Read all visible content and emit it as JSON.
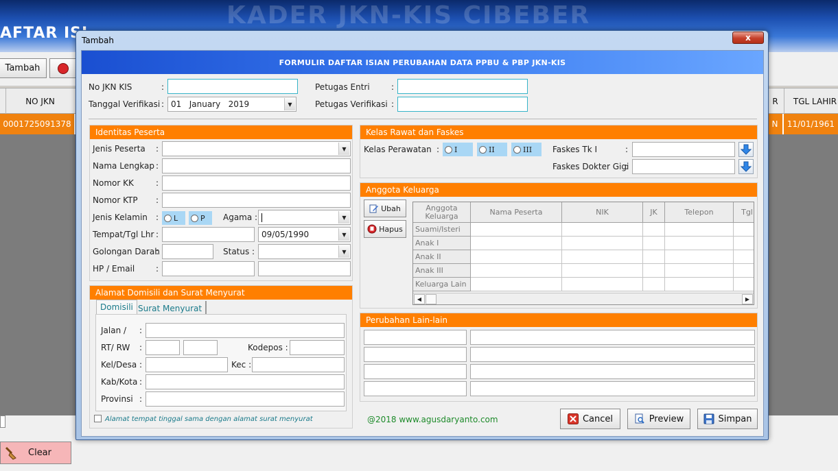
{
  "background": {
    "title": "AFTAR ISI",
    "header_ghost": "KADER JKN-KIS CIBEBER",
    "tambah_button": "Tambah",
    "clear_button": "Clear",
    "grid_headers": {
      "no_jkn": "NO JKN",
      "r": "R",
      "tgl_lahir": "TGL LAHIR"
    },
    "grid_row": {
      "no_jkn": "0001725091378",
      "r": "N",
      "tgl_lahir": "11/01/1961"
    }
  },
  "dialog": {
    "title": "Tambah",
    "close_label": "x",
    "banner": "FORMULIR DAFTAR ISIAN PERUBAHAN DATA PPBU & PBP JKN-KIS",
    "top": {
      "no_jkn_label": "No JKN KIS",
      "tanggal_label": "Tanggal Verifikasi",
      "tanggal_value": "01   January   2019",
      "petugas_entri_label": "Petugas Entri",
      "petugas_verif_label": "Petugas Verifikasi",
      "colon": ":"
    },
    "identitas": {
      "heading": "Identitas Peserta",
      "jenis_peserta": "Jenis Peserta",
      "nama_lengkap": "Nama Lengkap",
      "nomor_kk": "Nomor KK",
      "nomor_ktp": "Nomor KTP",
      "jenis_kelamin": "Jenis Kelamin",
      "gender_l": "L",
      "gender_p": "P",
      "agama": "Agama :",
      "tempat_tgl": "Tempat/Tgl Lhr",
      "tgl_value": "09/05/1990",
      "golongan_darah": "Golongan Darah",
      "status": "Status :",
      "hp_email": "HP / Email"
    },
    "alamat": {
      "heading": "Alamat Domisili dan Surat Menyurat",
      "tab_domisili": "Domisili",
      "tab_surat": "Surat Menyurat",
      "jalan": "Jalan /",
      "rt_rw": "RT/ RW",
      "kodepos": "Kodepos :",
      "kel_desa": "Kel/Desa",
      "kec": "Kec :",
      "kab_kota": "Kab/Kota",
      "provinsi": "Provinsi",
      "checkbox_label": "Alamat tempat tinggal sama dengan alamat surat menyurat"
    },
    "kelas": {
      "heading": "Kelas Rawat dan Faskes",
      "kelas_label": "Kelas Perawatan",
      "kelas_options": [
        "I",
        "II",
        "III"
      ],
      "faskes_tk1": "Faskes Tk I",
      "faskes_gigi": "Faskes Dokter Gigi"
    },
    "anggota": {
      "heading": "Anggota Keluarga",
      "ubah": "Ubah",
      "hapus": "Hapus",
      "columns": [
        "Anggota Keluarga",
        "Nama Peserta",
        "NIK",
        "JK",
        "Telepon",
        "Tgl"
      ],
      "rows": [
        "Suami/Isteri",
        "Anak I",
        "Anak II",
        "Anak III",
        "Keluarga Lain"
      ]
    },
    "perubahan": {
      "heading": "Perubahan Lain-lain"
    },
    "footer": {
      "credit": "@2018 www.agusdaryanto.com",
      "cancel": "Cancel",
      "preview": "Preview",
      "simpan": "Simpan"
    }
  },
  "colors": {
    "accent_orange": "#ff7f00",
    "banner_blue": "#2f6be6",
    "radio_bg": "#a9d7f5",
    "credit_green": "#1d8a2a"
  }
}
